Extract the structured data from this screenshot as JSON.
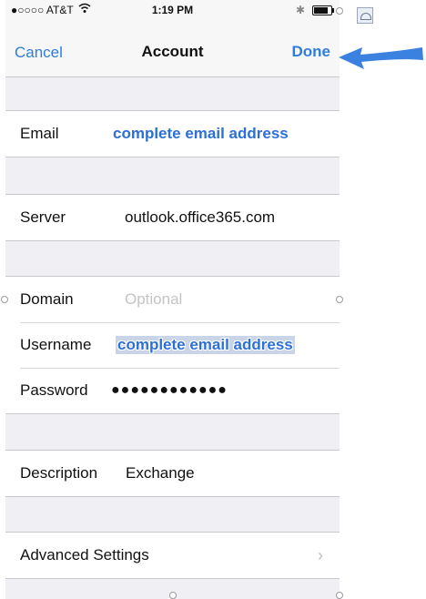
{
  "status_bar": {
    "carrier": "●○○○○ AT&T",
    "wifi_icon": "wifi-icon",
    "time": "1:19 PM",
    "bluetooth_icon": "bluetooth-icon",
    "battery_icon": "battery-icon"
  },
  "nav": {
    "cancel": "Cancel",
    "title": "Account",
    "done": "Done"
  },
  "form": {
    "email": {
      "label": "Email",
      "annotation": "complete email address"
    },
    "server": {
      "label": "Server",
      "value": "outlook.office365.com"
    },
    "domain": {
      "label": "Domain",
      "placeholder": "Optional"
    },
    "username": {
      "label": "Username",
      "annotation": "complete email address"
    },
    "password": {
      "label": "Password",
      "value": "●●●●●●●●●●●●"
    },
    "description": {
      "label": "Description",
      "value": "Exchange"
    },
    "advanced": {
      "label": "Advanced Settings",
      "chevron": "›"
    }
  },
  "colors": {
    "accent": "#2f7dd8",
    "annotation": "#2c6fd6",
    "arrow": "#3b82e0",
    "background": "#efeff4"
  }
}
